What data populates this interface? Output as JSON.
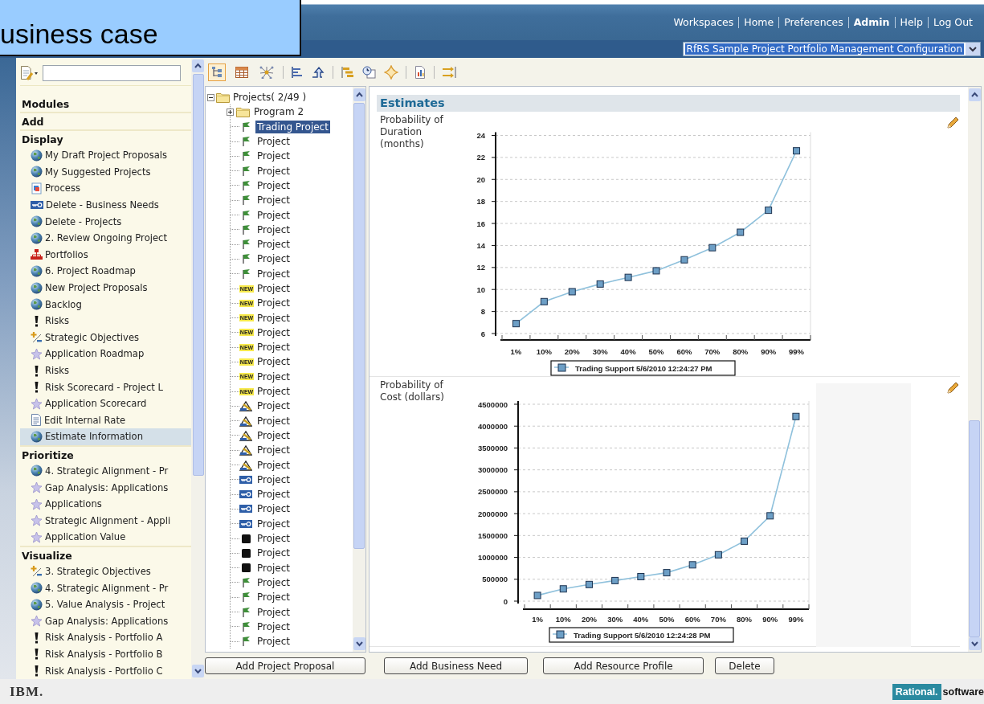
{
  "callout": {
    "text": "usiness case"
  },
  "nav": [
    {
      "label": "Workspaces",
      "selected": false
    },
    {
      "label": "Home",
      "selected": false
    },
    {
      "label": "Preferences",
      "selected": false
    },
    {
      "label": "Admin",
      "selected": true
    },
    {
      "label": "Help",
      "selected": false
    },
    {
      "label": "Log Out",
      "selected": false
    }
  ],
  "configuration": {
    "value": "RfRS Sample Project Portfolio Management Configuration"
  },
  "sidebar": {
    "sections": [
      {
        "title": "Modules"
      },
      {
        "title": "Add"
      },
      {
        "title": "Display",
        "items": [
          {
            "label": "My Draft Project Proposals",
            "kind": "globe",
            "selected": false
          },
          {
            "label": "My Suggested Projects",
            "kind": "globe",
            "selected": false
          },
          {
            "label": "Process",
            "kind": "process",
            "selected": false
          },
          {
            "label": "Delete - Business Needs",
            "kind": "key",
            "selected": false
          },
          {
            "label": "Delete - Projects",
            "kind": "globe",
            "selected": false
          },
          {
            "label": "2. Review Ongoing Project",
            "kind": "globe",
            "selected": false
          },
          {
            "label": "Portfolios",
            "kind": "hierarchy",
            "selected": false
          },
          {
            "label": "6. Project Roadmap",
            "kind": "globe",
            "selected": false
          },
          {
            "label": "New Project Proposals",
            "kind": "globe",
            "selected": false
          },
          {
            "label": "Backlog",
            "kind": "globe",
            "selected": false
          },
          {
            "label": "Risks",
            "kind": "alert",
            "selected": false
          },
          {
            "label": "Strategic Objectives",
            "kind": "objective",
            "selected": false
          },
          {
            "label": "Application Roadmap",
            "kind": "star",
            "selected": false
          },
          {
            "label": "Risks",
            "kind": "alert",
            "selected": false
          },
          {
            "label": "Risk Scorecard - Project L",
            "kind": "alert",
            "selected": false
          },
          {
            "label": "Application Scorecard",
            "kind": "star",
            "selected": false
          },
          {
            "label": "Edit Internal Rate",
            "kind": "document",
            "selected": false
          },
          {
            "label": "Estimate Information",
            "kind": "globe",
            "selected": true
          }
        ]
      },
      {
        "title": "Prioritize",
        "items": [
          {
            "label": "4. Strategic Alignment - Pr",
            "kind": "globe",
            "selected": false
          },
          {
            "label": "Gap Analysis: Applications",
            "kind": "star",
            "selected": false
          },
          {
            "label": "Applications",
            "kind": "star",
            "selected": false
          },
          {
            "label": "Strategic Alignment - Appli",
            "kind": "star",
            "selected": false
          },
          {
            "label": "Application Value",
            "kind": "star",
            "selected": false
          }
        ]
      },
      {
        "title": "Visualize",
        "items": [
          {
            "label": "3. Strategic Objectives",
            "kind": "objective",
            "selected": false
          },
          {
            "label": "4. Strategic Alignment - Pr",
            "kind": "globe",
            "selected": false
          },
          {
            "label": "5. Value Analysis - Project",
            "kind": "globe",
            "selected": false
          },
          {
            "label": "Gap Analysis: Applications",
            "kind": "star",
            "selected": false
          },
          {
            "label": "Risk Analysis - Portfolio A",
            "kind": "alert",
            "selected": false
          },
          {
            "label": "Risk Analysis - Portfolio B",
            "kind": "alert",
            "selected": false
          },
          {
            "label": "Risk Analysis - Portfolio C",
            "kind": "alert",
            "selected": false
          }
        ]
      }
    ]
  },
  "view_toggles": [
    {
      "selected": true
    },
    {
      "selected": false
    },
    {
      "selected": false
    }
  ],
  "tree": [
    {
      "label": "Projects( 2/49 )",
      "kind": "folder",
      "expanded": true,
      "selected": false,
      "children": [
        {
          "label": "Program 2",
          "kind": "folder",
          "expanded": false,
          "selected": false
        },
        {
          "label": "Trading Project",
          "kind": "flag",
          "selected": true
        },
        {
          "label": "Project",
          "kind": "flag",
          "selected": false
        },
        {
          "label": "Project",
          "kind": "flag",
          "selected": false
        },
        {
          "label": "Project",
          "kind": "flag",
          "selected": false
        },
        {
          "label": "Project",
          "kind": "flag",
          "selected": false
        },
        {
          "label": "Project",
          "kind": "flag",
          "selected": false
        },
        {
          "label": "Project",
          "kind": "flag",
          "selected": false
        },
        {
          "label": "Project",
          "kind": "flag",
          "selected": false
        },
        {
          "label": "Project",
          "kind": "flag",
          "selected": false
        },
        {
          "label": "Project",
          "kind": "flag",
          "selected": false
        },
        {
          "label": "Project",
          "kind": "flag",
          "selected": false
        },
        {
          "label": "Project",
          "kind": "new",
          "badge": "NEW",
          "selected": false
        },
        {
          "label": "Project",
          "kind": "new",
          "badge": "NEW",
          "selected": false
        },
        {
          "label": "Project",
          "kind": "new",
          "badge": "NEW",
          "selected": false
        },
        {
          "label": "Project",
          "kind": "new",
          "badge": "NEW",
          "selected": false
        },
        {
          "label": "Project",
          "kind": "new",
          "badge": "NEW",
          "selected": false
        },
        {
          "label": "Project",
          "kind": "new",
          "badge": "NEW",
          "selected": false
        },
        {
          "label": "Project",
          "kind": "new",
          "badge": "NEW",
          "selected": false
        },
        {
          "label": "Project",
          "kind": "new",
          "badge": "NEW",
          "selected": false
        },
        {
          "label": "Project",
          "kind": "pencil",
          "selected": false
        },
        {
          "label": "Project",
          "kind": "pencil",
          "selected": false
        },
        {
          "label": "Project",
          "kind": "pencil",
          "selected": false
        },
        {
          "label": "Project",
          "kind": "pencil",
          "selected": false
        },
        {
          "label": "Project",
          "kind": "pencil",
          "selected": false
        },
        {
          "label": "Project",
          "kind": "key",
          "selected": false
        },
        {
          "label": "Project",
          "kind": "key",
          "selected": false
        },
        {
          "label": "Project",
          "kind": "key",
          "selected": false
        },
        {
          "label": "Project",
          "kind": "key",
          "selected": false
        },
        {
          "label": "Project",
          "kind": "square",
          "selected": false
        },
        {
          "label": "Project",
          "kind": "square",
          "selected": false
        },
        {
          "label": "Project",
          "kind": "square",
          "selected": false
        },
        {
          "label": "Project",
          "kind": "flag",
          "selected": false
        },
        {
          "label": "Project",
          "kind": "flag",
          "selected": false
        },
        {
          "label": "Project",
          "kind": "flag",
          "selected": false
        },
        {
          "label": "Project",
          "kind": "flag",
          "selected": false
        },
        {
          "label": "Project",
          "kind": "flag",
          "selected": false
        }
      ]
    }
  ],
  "estimates": {
    "title": "Estimates",
    "charts": [
      {
        "chart_data": {
          "type": "line",
          "title": "Probability of Duration (months)",
          "categories": [
            "1%",
            "10%",
            "20%",
            "30%",
            "40%",
            "50%",
            "60%",
            "70%",
            "80%",
            "90%",
            "99%"
          ],
          "grid": true,
          "ylim": [
            6,
            24
          ],
          "yticks": [
            6,
            8,
            10,
            12,
            14,
            16,
            18,
            20,
            22,
            24
          ],
          "series": [
            {
              "name": "Trading Support 5/6/2010 12:24:27 PM",
              "color": "#8fc1dc",
              "marker": "square",
              "values": [
                6.9,
                8.9,
                9.8,
                10.5,
                11.1,
                11.7,
                12.7,
                13.8,
                15.2,
                17.2,
                22.6
              ]
            }
          ]
        }
      },
      {
        "chart_data": {
          "type": "line",
          "title": "Probability of Cost (dollars)",
          "categories": [
            "1%",
            "10%",
            "20%",
            "30%",
            "40%",
            "50%",
            "60%",
            "70%",
            "80%",
            "90%",
            "99%"
          ],
          "grid": true,
          "ylim": [
            0,
            4500000
          ],
          "yticks": [
            0,
            500000,
            1000000,
            1500000,
            2000000,
            2500000,
            3000000,
            3500000,
            4000000,
            4500000
          ],
          "series": [
            {
              "name": "Trading Support 5/6/2010 12:24:28 PM",
              "color": "#8fc1dc",
              "marker": "square",
              "values": [
                130000,
                280000,
                380000,
                470000,
                560000,
                650000,
                830000,
                1060000,
                1370000,
                1950000,
                4220000
              ]
            }
          ]
        }
      }
    ]
  },
  "buttons": [
    "Add Project Proposal",
    "Add Business Need",
    "Add Resource Profile",
    "Delete"
  ],
  "footer": {
    "logo": "IBM.",
    "brand": "Rational.",
    "brand_suffix": "software"
  }
}
